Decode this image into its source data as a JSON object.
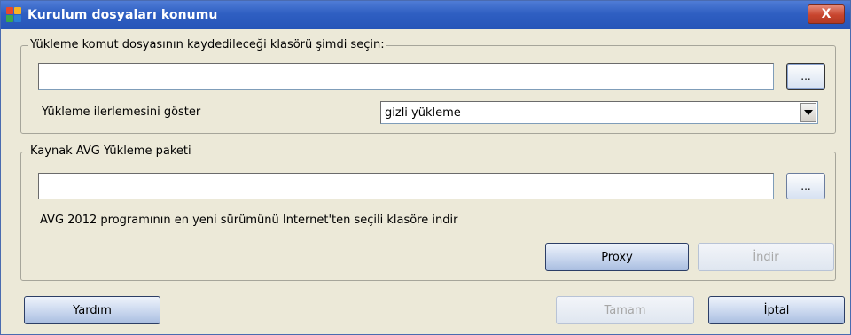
{
  "window": {
    "title": "Kurulum dosyaları konumu",
    "close_label": "X"
  },
  "folder_group": {
    "legend": "Yükleme komut dosyasının kaydedileceği klasörü şimdi seçin:",
    "path_value": "",
    "browse_label": "...",
    "progress_label": "Yükleme ilerlemesini göster",
    "progress_selected": "gizli yükleme"
  },
  "source_group": {
    "legend": "Kaynak AVG Yükleme paketi",
    "path_value": "",
    "browse_label": "...",
    "download_text": "AVG 2012 programının en yeni sürümünü Internet'ten seçili klasöre indir",
    "proxy_label": "Proxy",
    "download_label": "İndir"
  },
  "footer": {
    "help_label": "Yardım",
    "ok_label": "Tamam",
    "cancel_label": "İptal"
  }
}
